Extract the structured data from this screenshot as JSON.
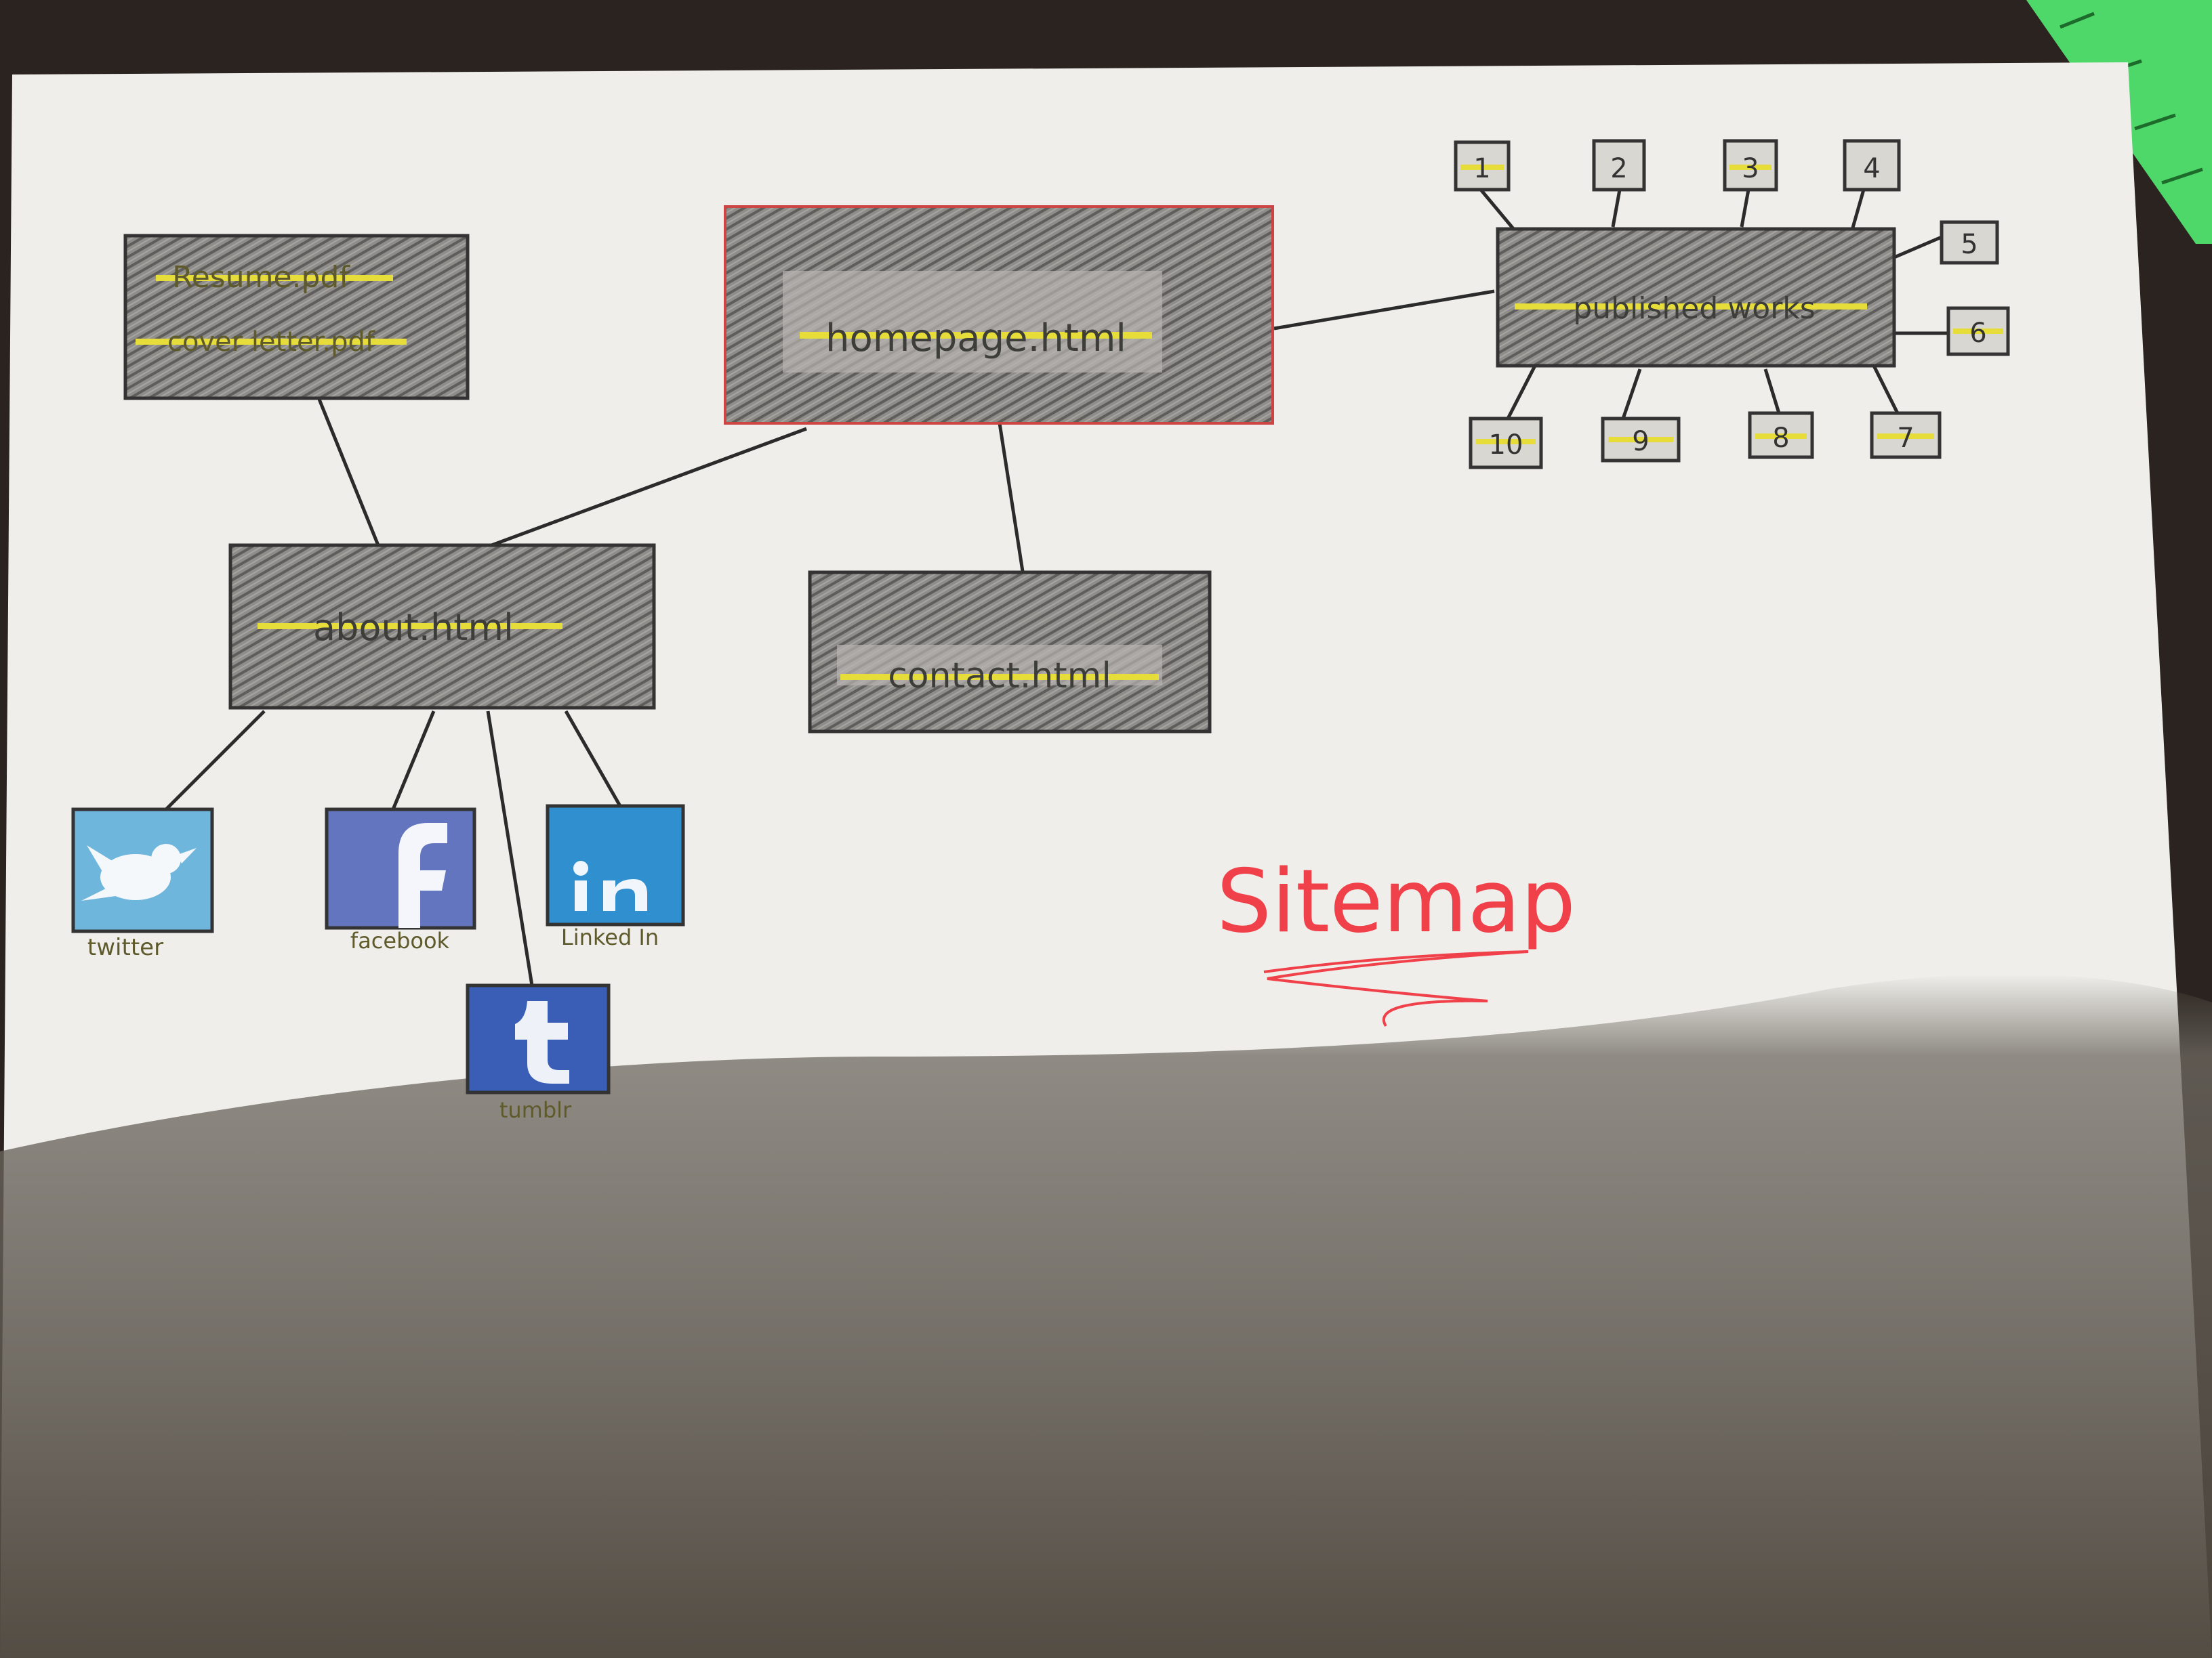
{
  "diagram": {
    "title": "Sitemap",
    "nodes": {
      "homepage": {
        "label": "homepage.html"
      },
      "resume": {
        "label_1": "Resume.pdf",
        "label_2": "cover letter.pdf"
      },
      "about": {
        "label": "about.html"
      },
      "contact": {
        "label": "contact.html"
      },
      "published": {
        "label": "published works"
      }
    },
    "pages": [
      "1",
      "2",
      "3",
      "4",
      "5",
      "6",
      "7",
      "8",
      "9",
      "10"
    ],
    "social": {
      "twitter": {
        "label": "twitter",
        "icon": "twitter-bird-icon"
      },
      "facebook": {
        "label": "facebook",
        "icon": "facebook-f-icon"
      },
      "linkedin": {
        "label": "Linked In",
        "icon": "linkedin-in-icon"
      },
      "tumblr": {
        "label": "tumblr",
        "icon": "tumblr-t-icon"
      }
    },
    "edges": [
      [
        "homepage",
        "about"
      ],
      [
        "homepage",
        "contact"
      ],
      [
        "homepage",
        "published"
      ],
      [
        "resume",
        "about"
      ],
      [
        "about",
        "twitter"
      ],
      [
        "about",
        "facebook"
      ],
      [
        "about",
        "tumblr"
      ],
      [
        "about",
        "linkedin"
      ],
      [
        "published",
        "page-1"
      ],
      [
        "published",
        "page-2"
      ],
      [
        "published",
        "page-3"
      ],
      [
        "published",
        "page-4"
      ],
      [
        "published",
        "page-5"
      ],
      [
        "published",
        "page-6"
      ],
      [
        "published",
        "page-7"
      ],
      [
        "published",
        "page-8"
      ],
      [
        "published",
        "page-9"
      ],
      [
        "published",
        "page-10"
      ]
    ],
    "colors": {
      "box_fill": "#8e8c89",
      "highlight": "#e6dc3a",
      "title": "#f0404a",
      "twitter": "#6fb6dd",
      "facebook": "#6275be",
      "linkedin": "#2f8fcf",
      "tumblr": "#3a5db6",
      "ruler": "#4ed86a"
    }
  }
}
